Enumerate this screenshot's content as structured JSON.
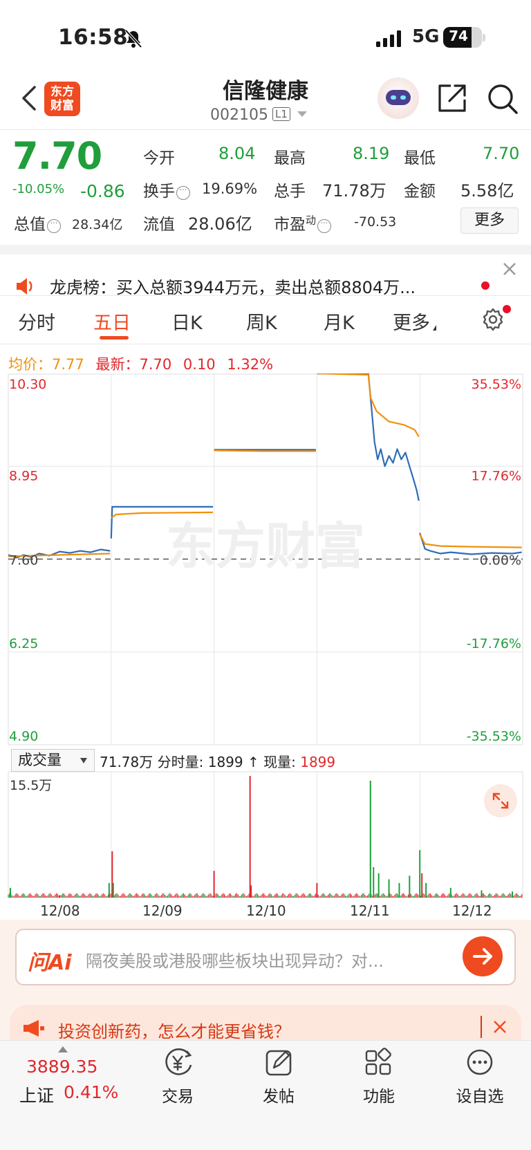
{
  "status_bar": {
    "time": "16:58",
    "network": "5G",
    "battery": "74",
    "battery_level": 0.74
  },
  "header": {
    "name": "信隆健康",
    "code": "002105",
    "level": "L1",
    "logo_line1": "东方",
    "logo_line2": "财富"
  },
  "quote": {
    "price": "7.70",
    "change_pct": "-10.05%",
    "change": "-0.86",
    "open_label": "今开",
    "open": "8.04",
    "high_label": "最高",
    "high": "8.19",
    "low_label": "最低",
    "low": "7.70",
    "turnover_label": "换手",
    "turnover": "19.69%",
    "volume_label": "总手",
    "volume": "71.78万",
    "amount_label": "金额",
    "amount": "5.58亿",
    "mktcap_label": "总值",
    "mktcap": "28.34亿",
    "float_label": "流值",
    "float": "28.06亿",
    "pe_label": "市盈",
    "pe_sup": "动",
    "pe": "-70.53",
    "more": "更多"
  },
  "notice": {
    "text": "龙虎榜：买入总额3944万元，卖出总额8804万..."
  },
  "tabs": [
    "分时",
    "五日",
    "日K",
    "周K",
    "月K",
    "更多"
  ],
  "legend": {
    "avg_label": "均价：",
    "avg": "7.77",
    "latest_label": "最新：",
    "latest": "7.70",
    "chg": "0.10",
    "chg_pct": "1.32%"
  },
  "chart_data": {
    "type": "line",
    "title": "",
    "x_days": [
      "12/08",
      "12/09",
      "12/10",
      "12/11",
      "12/12"
    ],
    "y_left_ticks": [
      "10.30",
      "8.95",
      "7.60",
      "6.25",
      "4.90"
    ],
    "y_right_ticks": [
      "35.53%",
      "17.76%",
      "0.00%",
      "-17.76%",
      "-35.53%"
    ],
    "ylim": [
      4.9,
      10.3
    ],
    "prev_close": 7.6,
    "series": [
      {
        "name": "最新",
        "color": "#2f6db5",
        "values": [
          [
            0,
            7.66
          ],
          [
            0.08,
            7.62
          ],
          [
            0.15,
            7.66
          ],
          [
            0.22,
            7.63
          ],
          [
            0.3,
            7.68
          ],
          [
            0.4,
            7.65
          ],
          [
            0.5,
            7.71
          ],
          [
            0.6,
            7.69
          ],
          [
            0.7,
            7.72
          ],
          [
            0.8,
            7.7
          ],
          [
            0.9,
            7.74
          ],
          [
            0.99,
            7.72
          ],
          [
            1.0,
            7.9
          ],
          [
            1.01,
            8.36
          ],
          [
            1.1,
            8.36
          ],
          [
            1.5,
            8.36
          ],
          [
            1.99,
            8.36
          ],
          [
            2.0,
            9.19
          ],
          [
            2.5,
            9.19
          ],
          [
            2.99,
            9.19
          ],
          [
            3.0,
            10.3
          ],
          [
            3.3,
            10.3
          ],
          [
            3.5,
            10.3
          ],
          [
            3.53,
            9.8
          ],
          [
            3.56,
            9.3
          ],
          [
            3.59,
            9.05
          ],
          [
            3.62,
            9.2
          ],
          [
            3.66,
            8.95
          ],
          [
            3.7,
            9.1
          ],
          [
            3.74,
            9.0
          ],
          [
            3.78,
            9.2
          ],
          [
            3.82,
            9.05
          ],
          [
            3.86,
            9.15
          ],
          [
            3.9,
            8.95
          ],
          [
            3.94,
            8.75
          ],
          [
            3.97,
            8.6
          ],
          [
            3.99,
            8.45
          ],
          [
            4.0,
            7.98
          ],
          [
            4.05,
            7.75
          ],
          [
            4.1,
            7.72
          ],
          [
            4.2,
            7.68
          ],
          [
            4.3,
            7.7
          ],
          [
            4.5,
            7.67
          ],
          [
            4.7,
            7.69
          ],
          [
            4.9,
            7.68
          ],
          [
            4.99,
            7.7
          ]
        ]
      },
      {
        "name": "均价",
        "color": "#f0900c",
        "values": [
          [
            0,
            7.64
          ],
          [
            0.5,
            7.66
          ],
          [
            0.99,
            7.68
          ],
          [
            1.0,
            8.2
          ],
          [
            1.05,
            8.25
          ],
          [
            1.3,
            8.27
          ],
          [
            1.99,
            8.28
          ],
          [
            2.0,
            9.18
          ],
          [
            2.5,
            9.17
          ],
          [
            2.99,
            9.17
          ],
          [
            3.0,
            10.3
          ],
          [
            3.5,
            10.28
          ],
          [
            3.52,
            9.95
          ],
          [
            3.58,
            9.75
          ],
          [
            3.7,
            9.6
          ],
          [
            3.85,
            9.55
          ],
          [
            3.95,
            9.48
          ],
          [
            3.99,
            9.38
          ],
          [
            4.0,
            7.96
          ],
          [
            4.05,
            7.82
          ],
          [
            4.2,
            7.79
          ],
          [
            4.5,
            7.78
          ],
          [
            4.99,
            7.77
          ]
        ]
      }
    ]
  },
  "volume": {
    "select": "成交量",
    "total": "71.78万",
    "tick_label": "分时量:",
    "tick": "1899",
    "now_label": "现量:",
    "now": "1899",
    "max_label": "15.5万",
    "bars": [
      {
        "x": 0.02,
        "v": 0.08,
        "c": "g"
      },
      {
        "x": 0.5,
        "v": 0.02,
        "c": "r"
      },
      {
        "x": 0.98,
        "v": 0.12,
        "c": "g"
      },
      {
        "x": 1.01,
        "v": 0.38,
        "c": "r"
      },
      {
        "x": 1.02,
        "v": 0.12,
        "c": "g"
      },
      {
        "x": 2.0,
        "v": 0.22,
        "c": "r"
      },
      {
        "x": 2.35,
        "v": 1.0,
        "c": "r"
      },
      {
        "x": 2.36,
        "v": 0.1,
        "c": "r"
      },
      {
        "x": 3.0,
        "v": 0.12,
        "c": "r"
      },
      {
        "x": 3.52,
        "v": 0.96,
        "c": "g"
      },
      {
        "x": 3.55,
        "v": 0.25,
        "c": "g"
      },
      {
        "x": 3.6,
        "v": 0.2,
        "c": "g"
      },
      {
        "x": 3.7,
        "v": 0.15,
        "c": "g"
      },
      {
        "x": 3.8,
        "v": 0.12,
        "c": "g"
      },
      {
        "x": 3.9,
        "v": 0.18,
        "c": "g"
      },
      {
        "x": 4.0,
        "v": 0.39,
        "c": "g"
      },
      {
        "x": 4.02,
        "v": 0.2,
        "c": "r"
      },
      {
        "x": 4.06,
        "v": 0.12,
        "c": "g"
      },
      {
        "x": 4.3,
        "v": 0.08,
        "c": "g"
      },
      {
        "x": 4.6,
        "v": 0.06,
        "c": "g"
      },
      {
        "x": 4.9,
        "v": 0.05,
        "c": "g"
      }
    ]
  },
  "ai": {
    "logo": "问Ai",
    "placeholder": "隔夜美股或港股哪些板块出现异动？对..."
  },
  "ad": {
    "text": "投资创新药，怎么才能更省钱？"
  },
  "bottom_nav": {
    "index_value": "3889.35",
    "index_name": "上证",
    "index_chg": "0.41%",
    "items": [
      "交易",
      "发帖",
      "功能",
      "设自选"
    ]
  },
  "watermark": "东方财富"
}
